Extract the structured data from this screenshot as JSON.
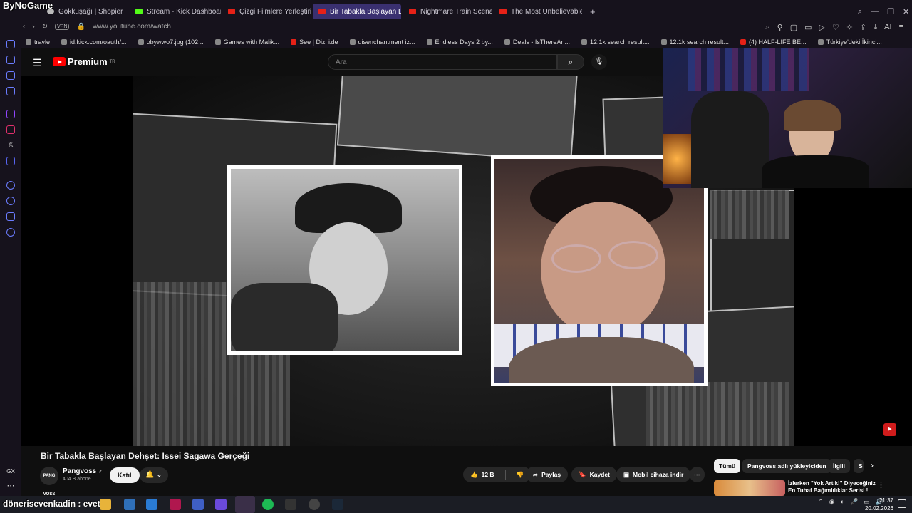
{
  "browser": {
    "logo_overlay": "ByNoGame",
    "tabs": [
      {
        "label": "Gökkuşağı | Shopier",
        "favicon": "shopier-icon"
      },
      {
        "label": "Stream - Kick Dashboard",
        "favicon": "kick-icon"
      },
      {
        "label": "Çizgi Filmlere Yerleştirilmi",
        "favicon": "youtube-icon"
      },
      {
        "label": "Bir Tabakla Başlayan Dehş",
        "favicon": "youtube-icon",
        "active": true
      },
      {
        "label": "Nightmare Train Scenario",
        "favicon": "youtube-icon"
      },
      {
        "label": "The Most Unbelievable Na",
        "favicon": "youtube-icon"
      }
    ],
    "new_tab": "+",
    "vpn_badge": "VPN",
    "url": "www.youtube.com/watch",
    "ai_label": "AI",
    "bookmarks": [
      "travle",
      "id.kick.com/oauth/...",
      "obywwo7.jpg (102...",
      "Games with Malik...",
      "See | Dizi izle",
      "disenchantment iz...",
      "Endless Days 2 by...",
      "Deals - IsThereAn...",
      "12.1k search result...",
      "12.1k search result...",
      "(4) HALF-LIFE BE...",
      "Türkiye'deki İkinci..."
    ]
  },
  "youtube": {
    "logo_text": "Premium",
    "logo_region": "TR",
    "search_placeholder": "Ara",
    "video_title": "Bir Tabakla Başlayan Dehşet: Issei Sagawa Gerçeği",
    "channel": {
      "avatar_text": "PANG VOSS",
      "name": "Pangvoss",
      "verified": "✓",
      "subscribers": "404 B abone",
      "join_label": "Katıl"
    },
    "actions": {
      "likes": "12 B",
      "share": "Paylaş",
      "save": "Kaydet",
      "download": "Mobil cihaza indir",
      "more": "⋯"
    },
    "chips": [
      "Tümü",
      "Pangvoss adlı yükleyiciden",
      "İlgili",
      "S"
    ],
    "recommendation": {
      "title": "İzlerken \"Yok Artık!\" Diyeceğiniz En Tuhaf Bağımlılıklar Serisi !"
    }
  },
  "taskbar": {
    "comment_overlay": "dönerisevenkadin : evet",
    "time": "21:37",
    "date": "20.02.2026"
  },
  "colors": {
    "yt_red": "#ff0000",
    "tab_active": "#3a3070",
    "chrome_bg": "#16121c"
  }
}
